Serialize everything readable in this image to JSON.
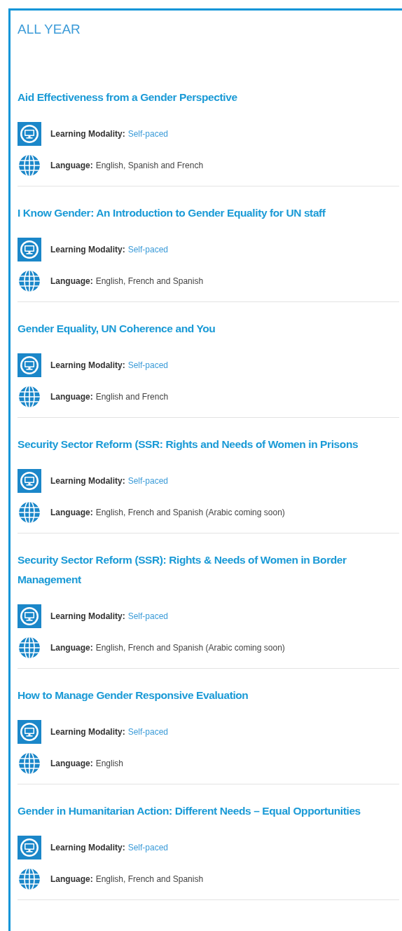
{
  "section": {
    "heading": "ALL YEAR"
  },
  "courses": [
    {
      "title": "Aid Effectiveness from a Gender Perspective",
      "details": [
        {
          "kind": "modality",
          "label": "Learning Modality:",
          "value": "Self-paced"
        },
        {
          "kind": "language",
          "label": "Language:",
          "value": "English, Spanish and French"
        }
      ]
    },
    {
      "title": "I Know Gender: An Introduction to Gender Equality for UN staff",
      "details": [
        {
          "kind": "modality",
          "label": "Learning Modality:",
          "value": "Self-paced"
        },
        {
          "kind": "language",
          "label": "Language:",
          "value": "English, French and Spanish"
        }
      ]
    },
    {
      "title": "Gender Equality, UN Coherence and You",
      "details": [
        {
          "kind": "modality",
          "label": "Learning Modality:",
          "value": "Self-paced"
        },
        {
          "kind": "language",
          "label": "Language:",
          "value": "English and French"
        }
      ]
    },
    {
      "title": "Security Sector Reform (SSR: Rights and Needs of Women in Prisons",
      "details": [
        {
          "kind": "modality",
          "label": "Learning Modality:",
          "value": "Self-paced"
        },
        {
          "kind": "language",
          "label": "Language:",
          "value": "English, French and Spanish (Arabic coming soon)"
        }
      ]
    },
    {
      "title": "Security Sector Reform (SSR): Rights & Needs of Women in Border Management",
      "details": [
        {
          "kind": "modality",
          "label": "Learning Modality:",
          "value": "Self-paced"
        },
        {
          "kind": "language",
          "label": "Language:",
          "value": "English, French and Spanish (Arabic coming soon)"
        }
      ]
    },
    {
      "title": "How to Manage Gender Responsive Evaluation",
      "details": [
        {
          "kind": "modality",
          "label": "Learning Modality:",
          "value": "Self-paced"
        },
        {
          "kind": "language",
          "label": "Language:",
          "value": "English"
        }
      ]
    },
    {
      "title": "Gender in Humanitarian Action: Different Needs – Equal Opportunities",
      "details": [
        {
          "kind": "modality",
          "label": "Learning Modality:",
          "value": "Self-paced"
        },
        {
          "kind": "language",
          "label": "Language:",
          "value": "English, French and Spanish"
        }
      ]
    }
  ]
}
